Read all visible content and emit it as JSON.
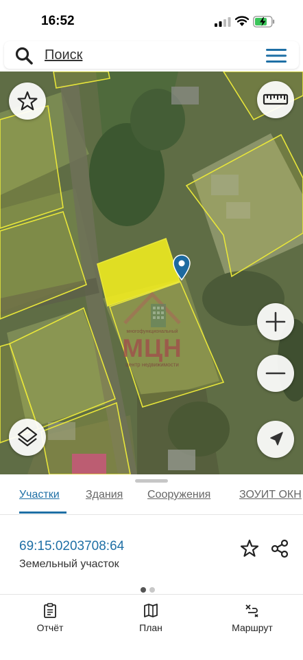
{
  "status_bar": {
    "time": "16:52"
  },
  "search": {
    "placeholder": "Поиск"
  },
  "map": {
    "watermark": {
      "top_text": "многофункциональный",
      "logo_text": "МЦН",
      "sub_text": "центр недвижимости"
    }
  },
  "sheet": {
    "tabs": [
      {
        "label": "Участки",
        "active": true
      },
      {
        "label": "Здания",
        "active": false
      },
      {
        "label": "Сооружения",
        "active": false
      },
      {
        "label": "ЗОУИТ ОКН",
        "active": false
      }
    ],
    "parcel": {
      "number": "69:15:0203708:64",
      "type": "Земельный участок"
    },
    "page_dots": {
      "count": 2,
      "active": 1
    }
  },
  "bottom_nav": [
    {
      "label": "Отчёт",
      "icon": "report-icon"
    },
    {
      "label": "План",
      "icon": "map-plan-icon"
    },
    {
      "label": "Маршрут",
      "icon": "route-icon"
    }
  ],
  "colors": {
    "accent": "#1e6fa5",
    "parcel_highlight": "#f2ee1f",
    "parcel_outline": "#e8e63a",
    "marker": "#1d6aa0"
  }
}
